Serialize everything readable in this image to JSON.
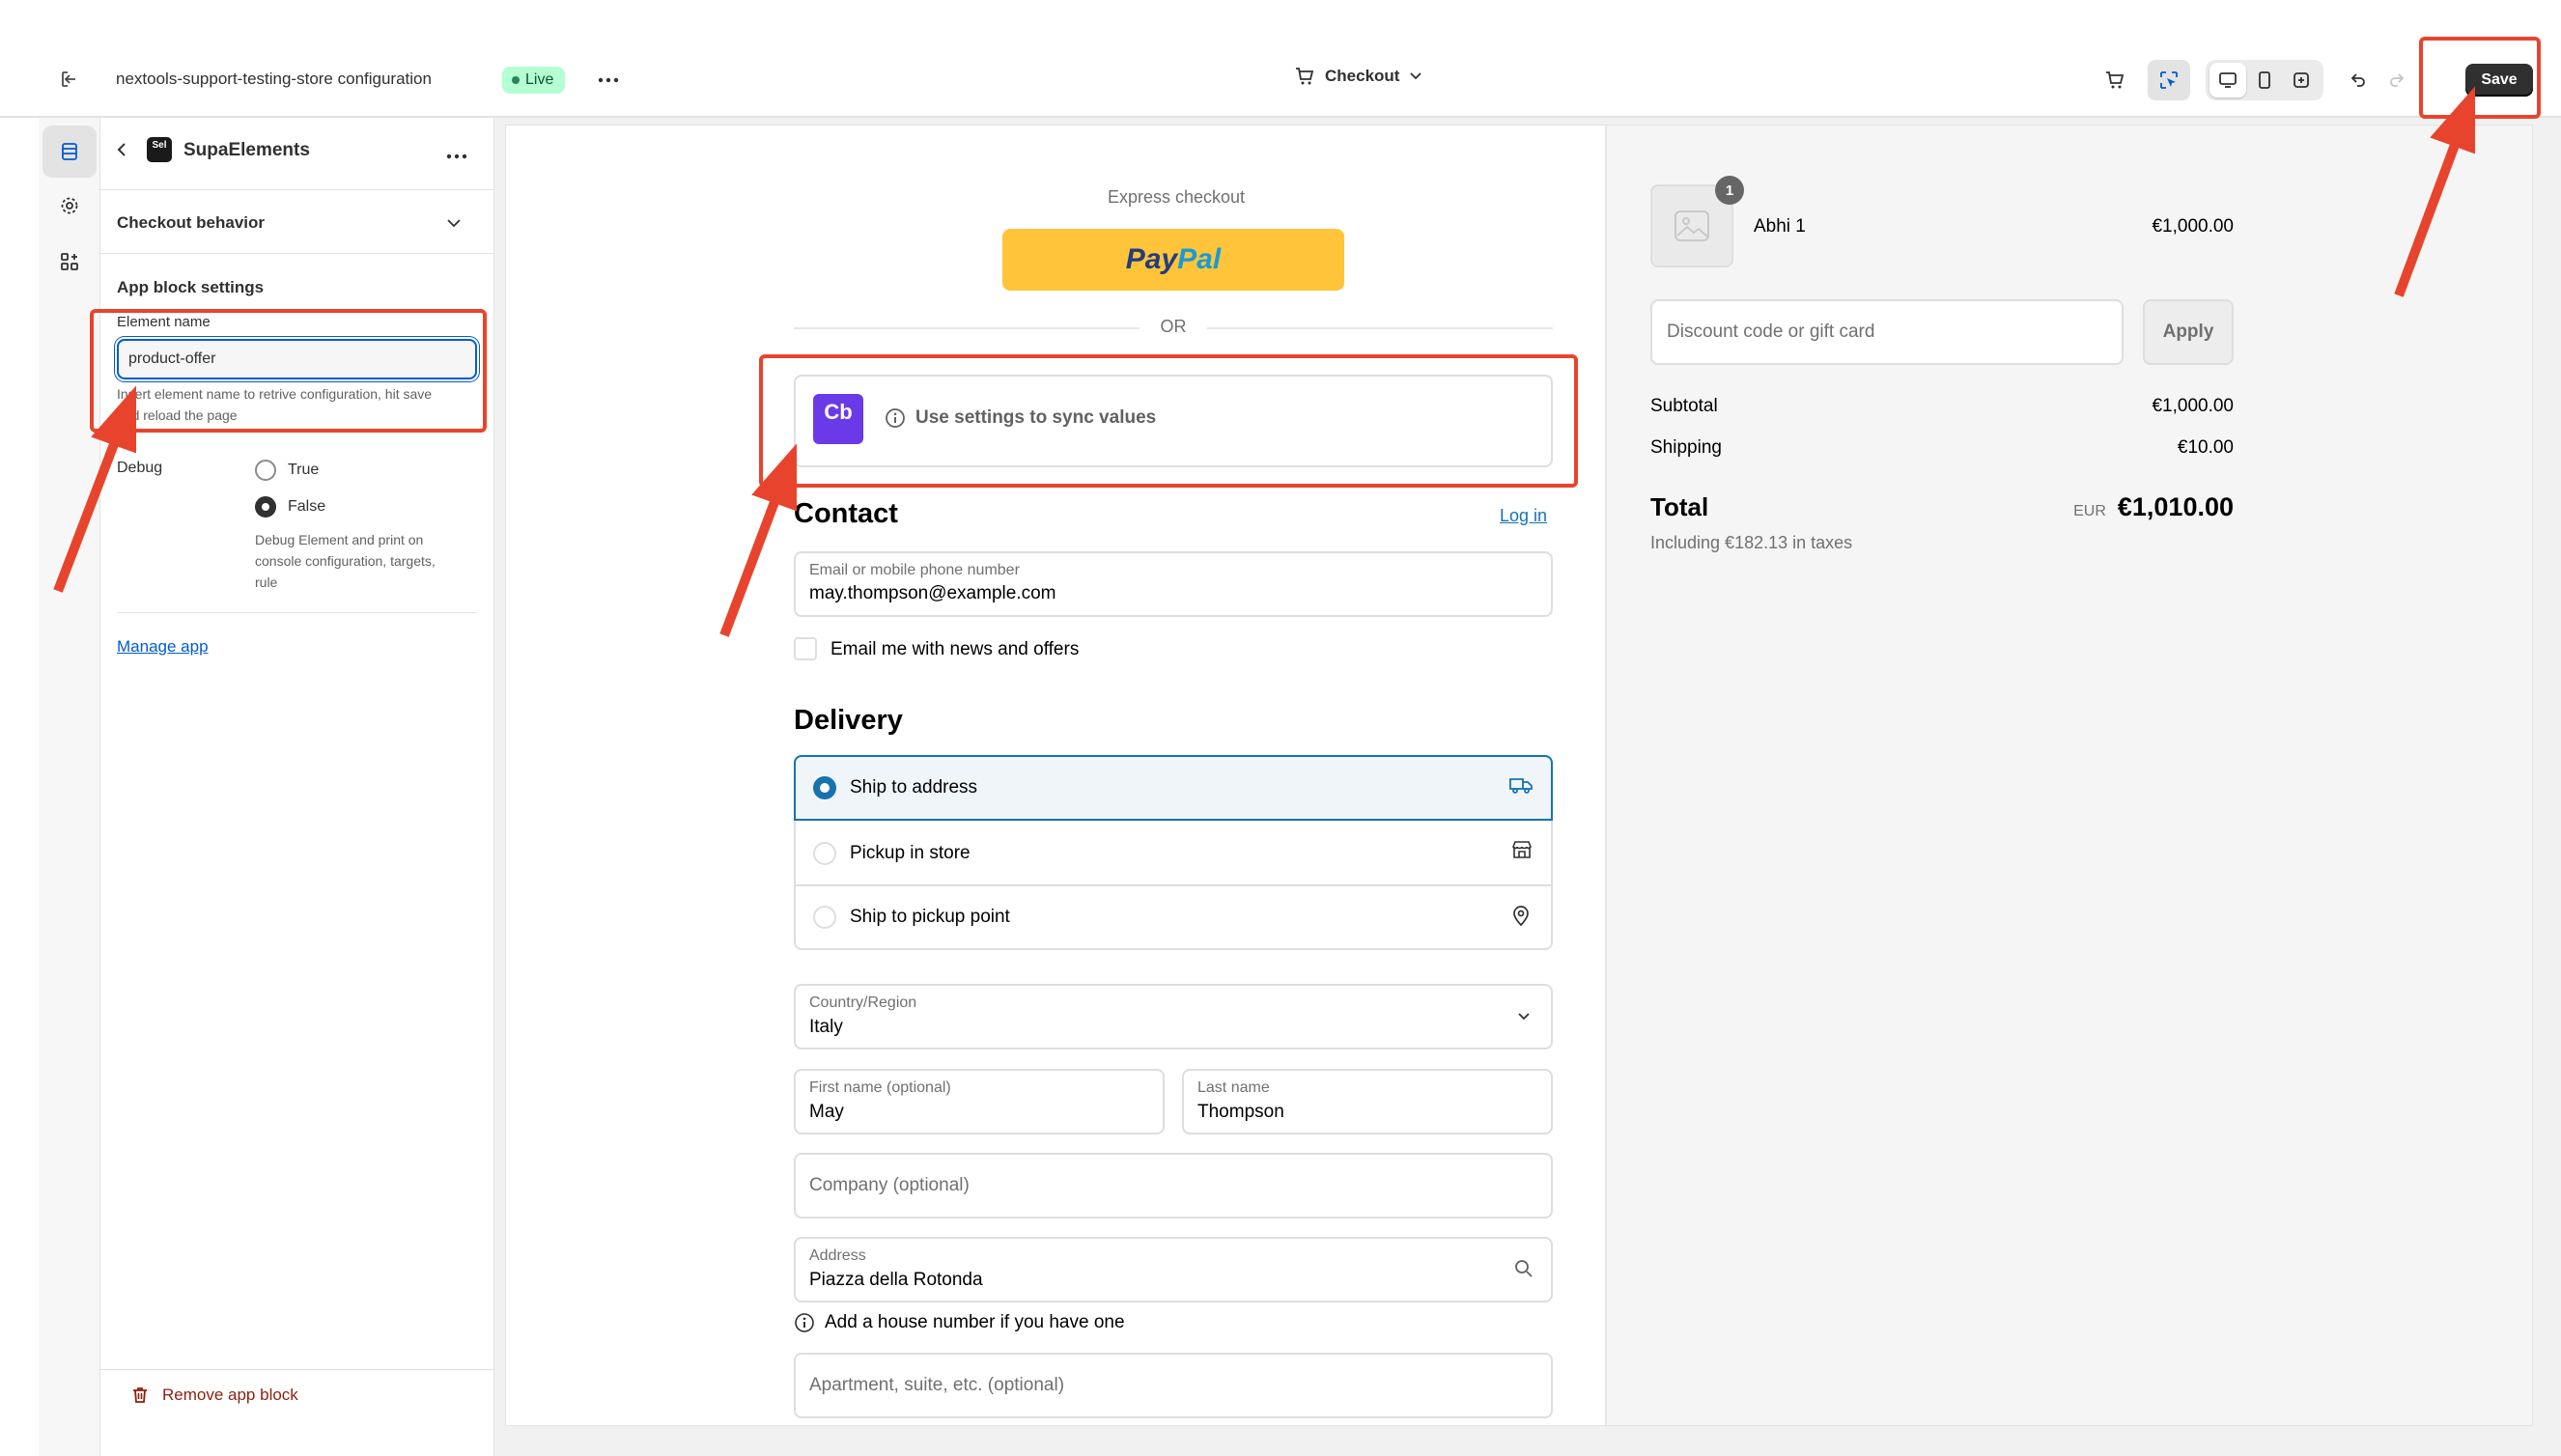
{
  "topbar": {
    "store_title": "nextools-support-testing-store configuration",
    "live_label": "Live",
    "page_selector": "Checkout",
    "save_label": "Save"
  },
  "panel": {
    "app_name": "SupaElements",
    "app_logo_text": "Sel",
    "checkout_behavior": "Checkout behavior",
    "block_settings_title": "App block settings",
    "element_name_label": "Element name",
    "element_name_value": "product-offer",
    "element_name_help_1": "Insert element name to retrive configuration, hit save",
    "element_name_help_2": "and reload the page",
    "debug_label": "Debug",
    "debug_options": [
      "True",
      "False"
    ],
    "debug_selected": "False",
    "debug_help_1": "Debug Element and print on",
    "debug_help_2": "console configuration, targets,",
    "debug_help_3": "rule",
    "manage_app": "Manage app",
    "remove_block": "Remove app block"
  },
  "checkout": {
    "express_title": "Express checkout",
    "paypal_pay": "Pay",
    "paypal_pal": "Pal",
    "or_label": "OR",
    "app_block_icon_text": "Cb",
    "app_block_message": "Use settings to sync values",
    "contact_title": "Contact",
    "login_link": "Log in",
    "email_label": "Email or mobile phone number",
    "email_value": "may.thompson@example.com",
    "newsletter_label": "Email me with news and offers",
    "delivery_title": "Delivery",
    "delivery_options": [
      "Ship to address",
      "Pickup in store",
      "Ship to pickup point"
    ],
    "country_label": "Country/Region",
    "country_value": "Italy",
    "first_name_label": "First name (optional)",
    "first_name_value": "May",
    "last_name_label": "Last name",
    "last_name_value": "Thompson",
    "company_placeholder": "Company (optional)",
    "address_label": "Address",
    "address_value": "Piazza della Rotonda",
    "house_number_hint": "Add a house number if you have one",
    "apartment_placeholder": "Apartment, suite, etc. (optional)"
  },
  "summary": {
    "product_name": "Abhi 1",
    "product_qty": "1",
    "product_price": "€1,000.00",
    "discount_placeholder": "Discount code or gift card",
    "apply_label": "Apply",
    "subtotal_label": "Subtotal",
    "subtotal_value": "€1,000.00",
    "shipping_label": "Shipping",
    "shipping_value": "€10.00",
    "total_label": "Total",
    "total_currency": "EUR",
    "total_value": "€1,010.00",
    "taxes_note": "Including €182.13 in taxes"
  },
  "colors": {
    "annotation_red": "#e8442d",
    "link_blue": "#005bd3",
    "paypal_yellow": "#ffc439",
    "checkout_blue": "#1773b0"
  }
}
